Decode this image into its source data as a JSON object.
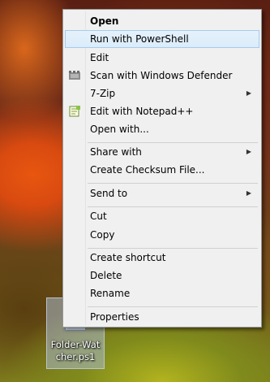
{
  "context_menu": {
    "items": [
      {
        "label": "Open"
      },
      {
        "label": "Run with PowerShell"
      },
      {
        "label": "Edit"
      },
      {
        "label": "Scan with Windows Defender",
        "icon": "windows-defender-icon"
      },
      {
        "label": "7-Zip"
      },
      {
        "label": "Edit with Notepad++",
        "icon": "notepad-plus-plus-icon"
      },
      {
        "label": "Open with..."
      },
      {
        "label": "Share with"
      },
      {
        "label": "Create Checksum File..."
      },
      {
        "label": "Send to"
      },
      {
        "label": "Cut"
      },
      {
        "label": "Copy"
      },
      {
        "label": "Create shortcut"
      },
      {
        "label": "Delete"
      },
      {
        "label": "Rename"
      },
      {
        "label": "Properties"
      }
    ],
    "submenu_arrow": "▶",
    "highlight_color": "#dbecfa"
  },
  "desktop": {
    "icon_label": "Folder-Watcher.ps1"
  }
}
